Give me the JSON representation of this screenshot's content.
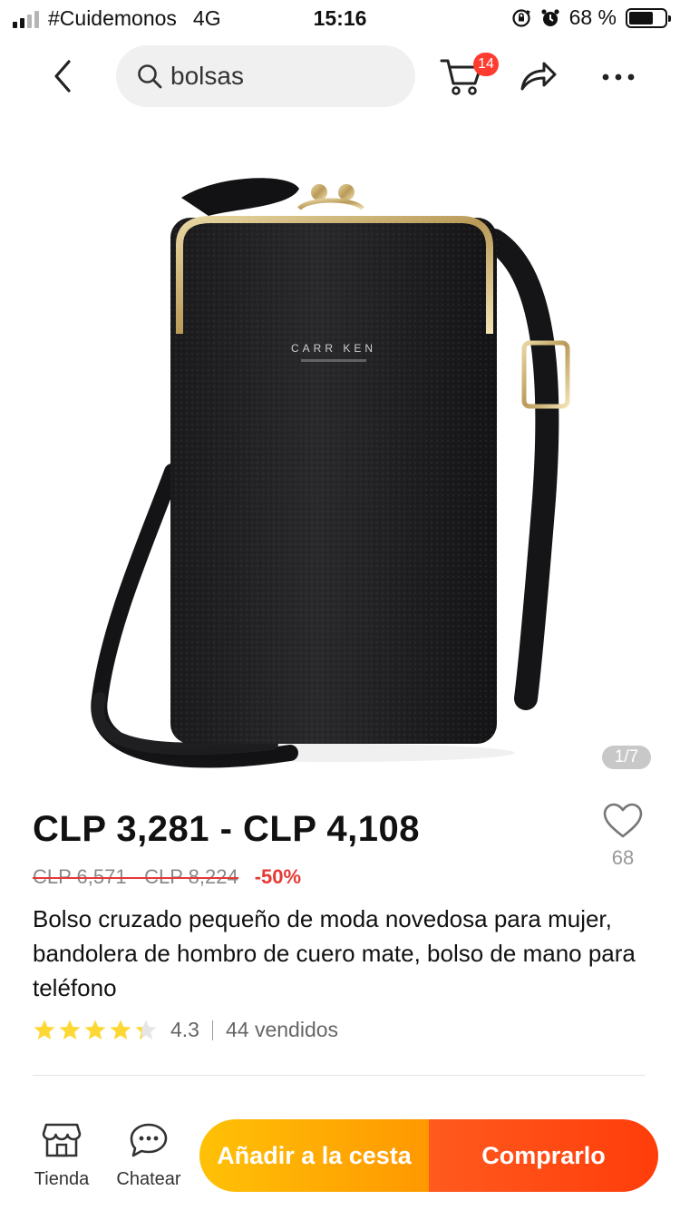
{
  "status_bar": {
    "carrier": "#Cuidemonos",
    "network": "4G",
    "time": "15:16",
    "battery_text": "68 %",
    "battery_level": 0.68,
    "icons": [
      "signal-icon",
      "orientation-lock-icon",
      "alarm-icon",
      "battery-icon"
    ]
  },
  "nav": {
    "search_value": "bolsas",
    "cart_count": "14",
    "icons": [
      "back-icon",
      "search-icon",
      "cart-icon",
      "share-icon",
      "more-icon"
    ]
  },
  "product": {
    "image_counter": "1/7",
    "brand_text": "CARR KEN",
    "price": "CLP 3,281 - CLP 4,108",
    "old_price": "CLP 6,571 - CLP 8,224",
    "discount": "-50%",
    "wishlist_count": "68",
    "title": "Bolso cruzado pequeño de moda novedosa para mujer, bandolera de hombro de cuero mate, bolso de mano para teléfono",
    "rating": "4.3",
    "rating_value": 4.3,
    "sold": "44 vendidos"
  },
  "bottom_bar": {
    "store_label": "Tienda",
    "chat_label": "Chatear",
    "add_to_cart_label": "Añadir a la cesta",
    "buy_label": "Comprarlo"
  },
  "colors": {
    "accent_red": "#e53935",
    "badge_red": "#ff3b30",
    "cart_button": "#ffa000",
    "buy_button": "#ff4a12",
    "star": "#fdd835"
  }
}
